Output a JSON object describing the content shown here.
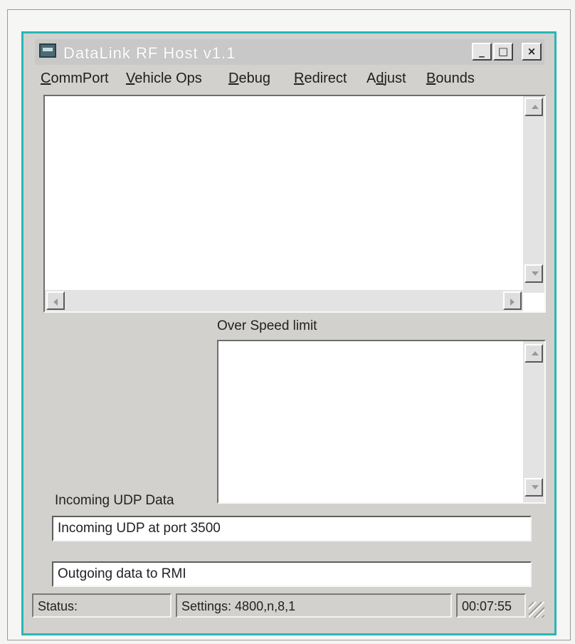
{
  "window": {
    "title": "DataLink RF Host v1.1",
    "controls": {
      "minimize": "_",
      "maximize": "□",
      "close": "×"
    }
  },
  "menu": [
    {
      "pre": "",
      "u": "C",
      "post": "ommPort"
    },
    {
      "pre": "",
      "u": "V",
      "post": "ehicle Ops"
    },
    {
      "pre": "",
      "u": "D",
      "post": "ebug"
    },
    {
      "pre": "",
      "u": "R",
      "post": "edirect"
    },
    {
      "pre": "A",
      "u": "d",
      "post": "just"
    },
    {
      "pre": "",
      "u": "B",
      "post": "ounds"
    }
  ],
  "main_log": {
    "text": ""
  },
  "over_speed": {
    "label": "Over Speed limit",
    "text": ""
  },
  "incoming": {
    "label": "Incoming UDP Data",
    "value": "Incoming UDP at port 3500"
  },
  "outgoing": {
    "value": "Outgoing data to RMI"
  },
  "status": {
    "status": "Status:",
    "settings": "Settings: 4800,n,8,1",
    "time": "00:07:55"
  },
  "colors": {
    "window_border": "#29b6b6",
    "face": "#d3d1cd"
  }
}
